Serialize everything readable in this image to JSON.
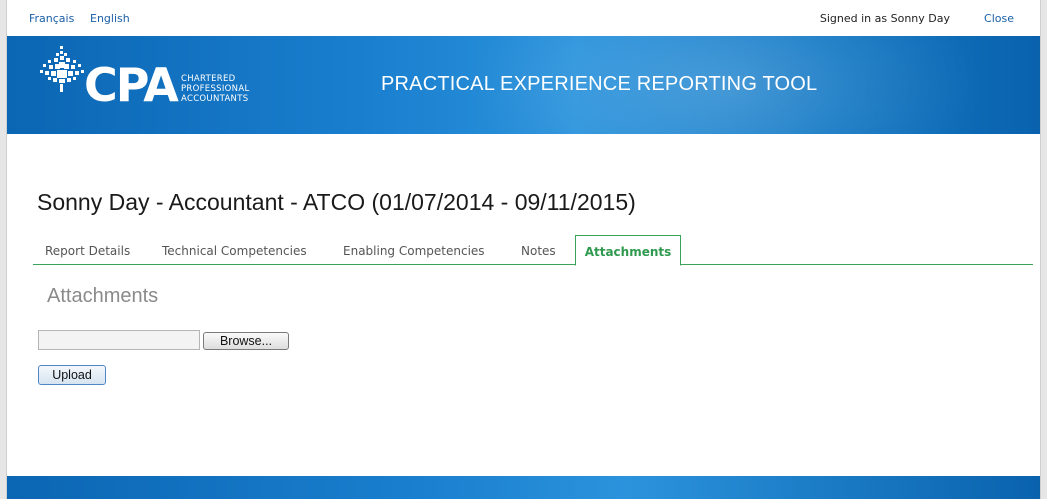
{
  "topbar": {
    "lang_fr": "Français",
    "lang_en": "English",
    "signed_in": "Signed in as Sonny Day",
    "close": "Close"
  },
  "banner": {
    "logo_text": "CPA",
    "logo_sub": [
      "CHARTERED",
      "PROFESSIONAL",
      "ACCOUNTANTS"
    ],
    "app_title": "PRACTICAL EXPERIENCE REPORTING TOOL"
  },
  "report": {
    "title": "Sonny Day - Accountant - ATCO (01/07/2014 - 09/11/2015)"
  },
  "tabs": [
    {
      "label": "Report Details",
      "active": false
    },
    {
      "label": "Technical Competencies",
      "active": false
    },
    {
      "label": "Enabling Competencies",
      "active": false
    },
    {
      "label": "Notes",
      "active": false
    },
    {
      "label": "Attachments",
      "active": true
    }
  ],
  "attachments": {
    "section_title": "Attachments",
    "file_value": "",
    "browse_label": "Browse...",
    "upload_label": "Upload"
  },
  "colors": {
    "brand_blue": "#1277c3",
    "link_blue": "#1a5fa8",
    "active_tab_green": "#2f9a4f",
    "tab_border_green": "#3aa35a"
  }
}
